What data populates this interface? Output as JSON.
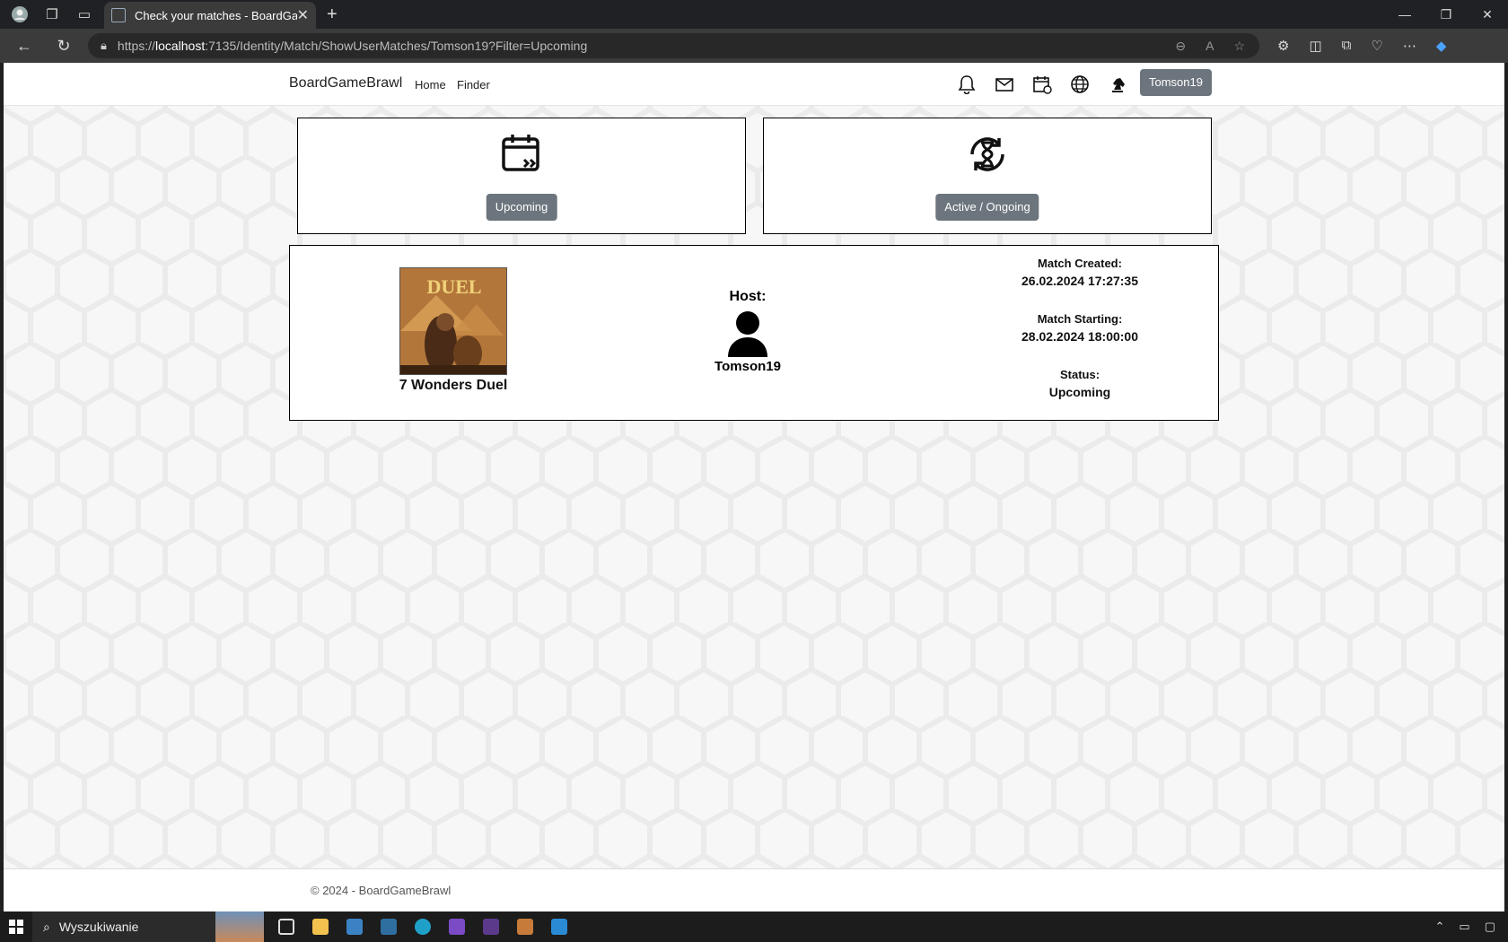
{
  "browser": {
    "tab_title": "Check your matches - BoardGam",
    "url_prefix": "https://",
    "url_host": "localhost",
    "url_rest": ":7135/Identity/Match/ShowUserMatches/Tomson19?Filter=Upcoming"
  },
  "navbar": {
    "brand": "BoardGameBrawl",
    "links": [
      "Home",
      "Finder"
    ],
    "user_button": "Tomson19",
    "icons": [
      "bell-icon",
      "envelope-icon",
      "calendar-icon",
      "globe-icon",
      "chess-knight-icon"
    ]
  },
  "filters": {
    "upcoming_label": "Upcoming",
    "active_label": "Active / Ongoing"
  },
  "match": {
    "game_name": "7 Wonders Duel",
    "cover_text": "DUEL",
    "host_label": "Host:",
    "host_name": "Tomson19",
    "created_label": "Match Created:",
    "created_value": "26.02.2024 17:27:35",
    "starting_label": "Match Starting:",
    "starting_value": "28.02.2024 18:00:00",
    "status_label": "Status:",
    "status_value": "Upcoming"
  },
  "footer": {
    "text": "© 2024 - BoardGameBrawl"
  },
  "taskbar": {
    "search_placeholder": "Wyszukiwanie"
  },
  "colors": {
    "button_gray": "#6c757d",
    "page_bg": "#f7f7f7"
  }
}
